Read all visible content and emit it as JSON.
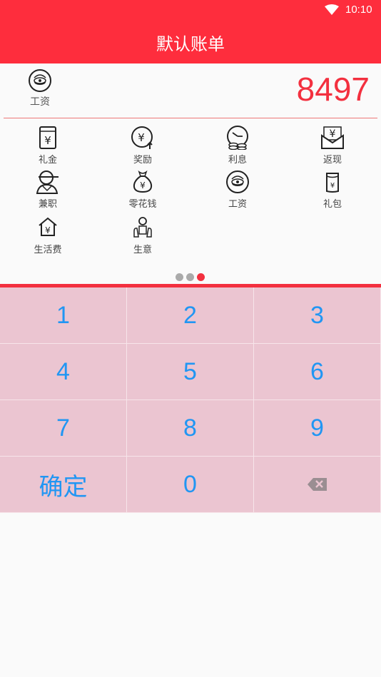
{
  "status_bar": {
    "time": "10:10",
    "wifi_icon": "wifi-icon"
  },
  "header": {
    "title": "默认账单"
  },
  "selected_category": {
    "label": "工资",
    "icon": "salary-coin-icon"
  },
  "amount": "8497",
  "categories": [
    {
      "label": "礼金",
      "icon": "gift-money-icon"
    },
    {
      "label": "奖励",
      "icon": "reward-icon"
    },
    {
      "label": "利息",
      "icon": "interest-icon"
    },
    {
      "label": "返现",
      "icon": "cashback-icon"
    },
    {
      "label": "兼职",
      "icon": "part-time-icon"
    },
    {
      "label": "零花钱",
      "icon": "pocket-money-icon"
    },
    {
      "label": "工资",
      "icon": "salary-coin-icon"
    },
    {
      "label": "礼包",
      "icon": "gift-pack-icon"
    },
    {
      "label": "生活费",
      "icon": "living-expense-icon"
    },
    {
      "label": "生意",
      "icon": "business-icon"
    }
  ],
  "pager": {
    "total": 3,
    "active_index": 2
  },
  "keypad": {
    "keys": [
      "1",
      "2",
      "3",
      "4",
      "5",
      "6",
      "7",
      "8",
      "9"
    ],
    "confirm_label": "确定",
    "zero_label": "0",
    "delete_icon": "backspace-icon"
  },
  "colors": {
    "accent": "#fe2d3d",
    "keypad_bg": "#ebc5d1",
    "key_text": "#2196f3"
  }
}
